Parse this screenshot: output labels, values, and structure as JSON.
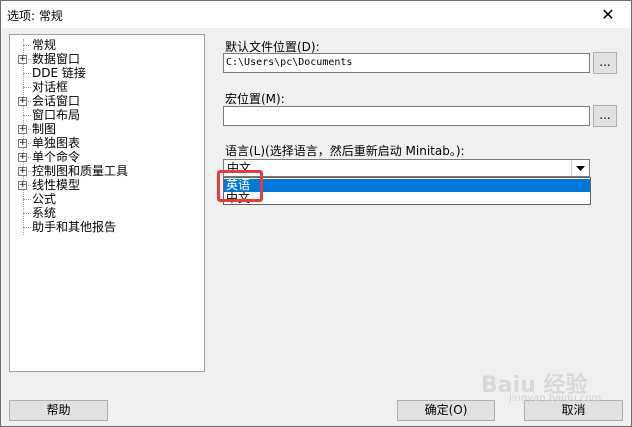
{
  "window": {
    "title": "选项: 常规",
    "close_glyph": "✕"
  },
  "tree": {
    "items": [
      {
        "label": "常规",
        "expandable": false
      },
      {
        "label": "数据窗口",
        "expandable": true
      },
      {
        "label": "DDE 链接",
        "expandable": false
      },
      {
        "label": "对话框",
        "expandable": false
      },
      {
        "label": "会话窗口",
        "expandable": true
      },
      {
        "label": "窗口布局",
        "expandable": false
      },
      {
        "label": "制图",
        "expandable": true
      },
      {
        "label": "单独图表",
        "expandable": true
      },
      {
        "label": "单个命令",
        "expandable": true
      },
      {
        "label": "控制图和质量工具",
        "expandable": true
      },
      {
        "label": "线性模型",
        "expandable": true
      },
      {
        "label": "公式",
        "expandable": false
      },
      {
        "label": "系统",
        "expandable": false
      },
      {
        "label": "助手和其他报告",
        "expandable": false
      }
    ],
    "expand_glyph": "+"
  },
  "fields": {
    "default_location_label": "默认文件位置(D):",
    "default_location_value": "C:\\Users\\pc\\Documents",
    "macro_location_label": "宏位置(M):",
    "macro_location_value": "",
    "browse_label": "...",
    "language_label": "语言(L)(选择语言，然后重新启动 Minitab。):",
    "language_value": "中文",
    "language_options": [
      "英语",
      "中文"
    ],
    "language_selected_index": 0
  },
  "buttons": {
    "help": "帮助",
    "ok": "确定(O)",
    "cancel": "取消"
  },
  "watermark": {
    "text": "Baiu 经验",
    "sub": "jingyan.baidu.com"
  },
  "colors": {
    "selection": "#0078d7",
    "highlight": "#e43b3b"
  }
}
